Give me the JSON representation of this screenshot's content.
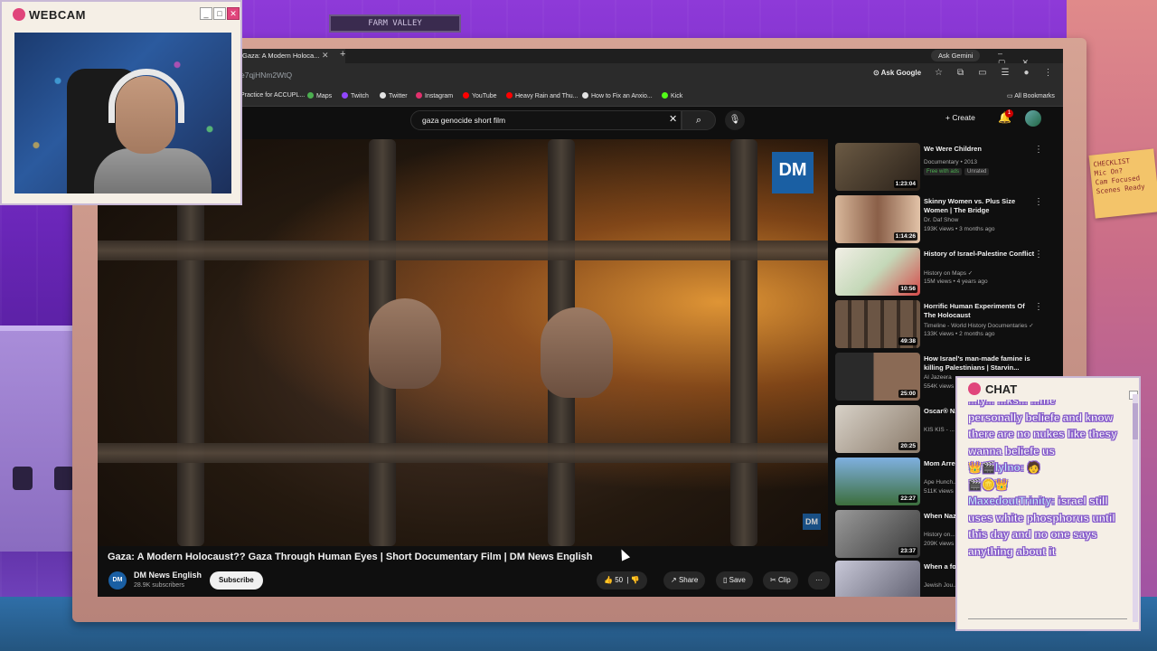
{
  "room": {
    "sign_text": "FARM VALLEY",
    "sticky_note_lines": [
      "CHECKLIST",
      "Mic On?",
      "Cam Focused",
      "Scenes Ready"
    ]
  },
  "webcam": {
    "title": "WEBCAM",
    "buttons": [
      "_",
      "□",
      "✕"
    ]
  },
  "browser": {
    "tab_title": "Gaza: A Modern Holoca...",
    "ask_gemini": "Ask Gemini",
    "url": "e7qjHNm2WtQ",
    "ask_google": "Ask Google",
    "bookmarks": [
      {
        "label": "Practice for ACCUPL...",
        "color": "#9aa0a6"
      },
      {
        "label": "Maps",
        "color": "#4caf50"
      },
      {
        "label": "Twitch",
        "color": "#9146ff"
      },
      {
        "label": "Twitter",
        "color": "#e3e3e3"
      },
      {
        "label": "Instagram",
        "color": "#e1306c"
      },
      {
        "label": "YouTube",
        "color": "#ff0000"
      },
      {
        "label": "Heavy Rain and Thu...",
        "color": "#ff0000"
      },
      {
        "label": "How to Fix an Anxio...",
        "color": "#e3e3e3"
      },
      {
        "label": "Kick",
        "color": "#53fc18"
      }
    ],
    "all_bookmarks": "All Bookmarks"
  },
  "youtube": {
    "search_query": "gaza genocide short film",
    "create_label": "Create",
    "notification_count": "1"
  },
  "video": {
    "title": "Gaza: A Modern Holocaust?? Gaza Through Human Eyes | Short Documentary Film | DM News English",
    "logo_text": "DM",
    "channel_avatar_text": "DM",
    "channel_name": "DM News English",
    "channel_subs": "28.9K subscribers",
    "subscribe_label": "Subscribe",
    "like_count": "50",
    "share_label": "Share",
    "save_label": "Save",
    "clip_label": "Clip",
    "more_label": "···"
  },
  "recommendations": [
    {
      "title": "We Were Children",
      "meta1": "Documentary • 2013",
      "tags": [
        "Free with ads",
        "Unrated"
      ],
      "duration": "1:23:04",
      "thumb": "#4a3b2a"
    },
    {
      "title": "Skinny Women vs. Plus Size Women | The Bridge",
      "meta1": "Dr. Daf Show",
      "meta2": "193K views • 3 months ago",
      "duration": "1:14:26",
      "thumb": "#c9a38a"
    },
    {
      "title": "History of Israel-Palestine Conflict",
      "meta1": "History on Maps ✓",
      "meta2": "15M views • 4 years ago",
      "duration": "10:56",
      "thumb": "#e8e4d8"
    },
    {
      "title": "Horrific Human Experiments Of The Holocaust",
      "meta1": "Timeline - World History Documentaries ✓",
      "meta2": "133K views • 2 months ago",
      "duration": "49:38",
      "thumb": "#5c4a3a"
    },
    {
      "title": "How Israel's man-made famine is killing Palestinians | Starvin...",
      "meta1": "Al Jazeera",
      "meta2": "554K views",
      "duration": "25:00",
      "thumb": "#3a3a3a"
    },
    {
      "title": "Oscar® N... on a scho...",
      "meta1": "KIS KIS - ...",
      "meta2": "",
      "duration": "20:25",
      "thumb": "#b8b0a6"
    },
    {
      "title": "Mom Arre... With Fam...",
      "meta1": "Ape Hunch...",
      "meta2": "511K views",
      "duration": "22:27",
      "thumb": "#5a7fb0"
    },
    {
      "title": "When Naz... Camps W...",
      "meta1": "History on...",
      "meta2": "209K views",
      "duration": "23:37",
      "thumb": "#6b6b6b"
    },
    {
      "title": "When a fo... Holocaust...",
      "meta1": "Jewish Jou...",
      "meta2": "",
      "duration": "",
      "thumb": "#8a8a9a"
    }
  ],
  "chat": {
    "title": "CHAT",
    "lines": [
      {
        "user": "",
        "text": "...ly... ...ks... ...me"
      },
      {
        "user": "",
        "text": "personally beliefe and know there are no nukes like thesy wanna beliefe us"
      },
      {
        "user": "👑🎬lylno:",
        "text": "🧑"
      },
      {
        "user": "",
        "text": "🎬🪙👑"
      },
      {
        "user": "MaxedoutTrinity:",
        "text": "israel still uses white phosphorus until this day and no one says anything about it"
      }
    ]
  },
  "colors": {
    "yt_bg": "#0f0f0f",
    "accent_pink": "#e0457b",
    "dm_blue": "#1a5fa3",
    "chat_text_outline": "#8a5ed0"
  }
}
